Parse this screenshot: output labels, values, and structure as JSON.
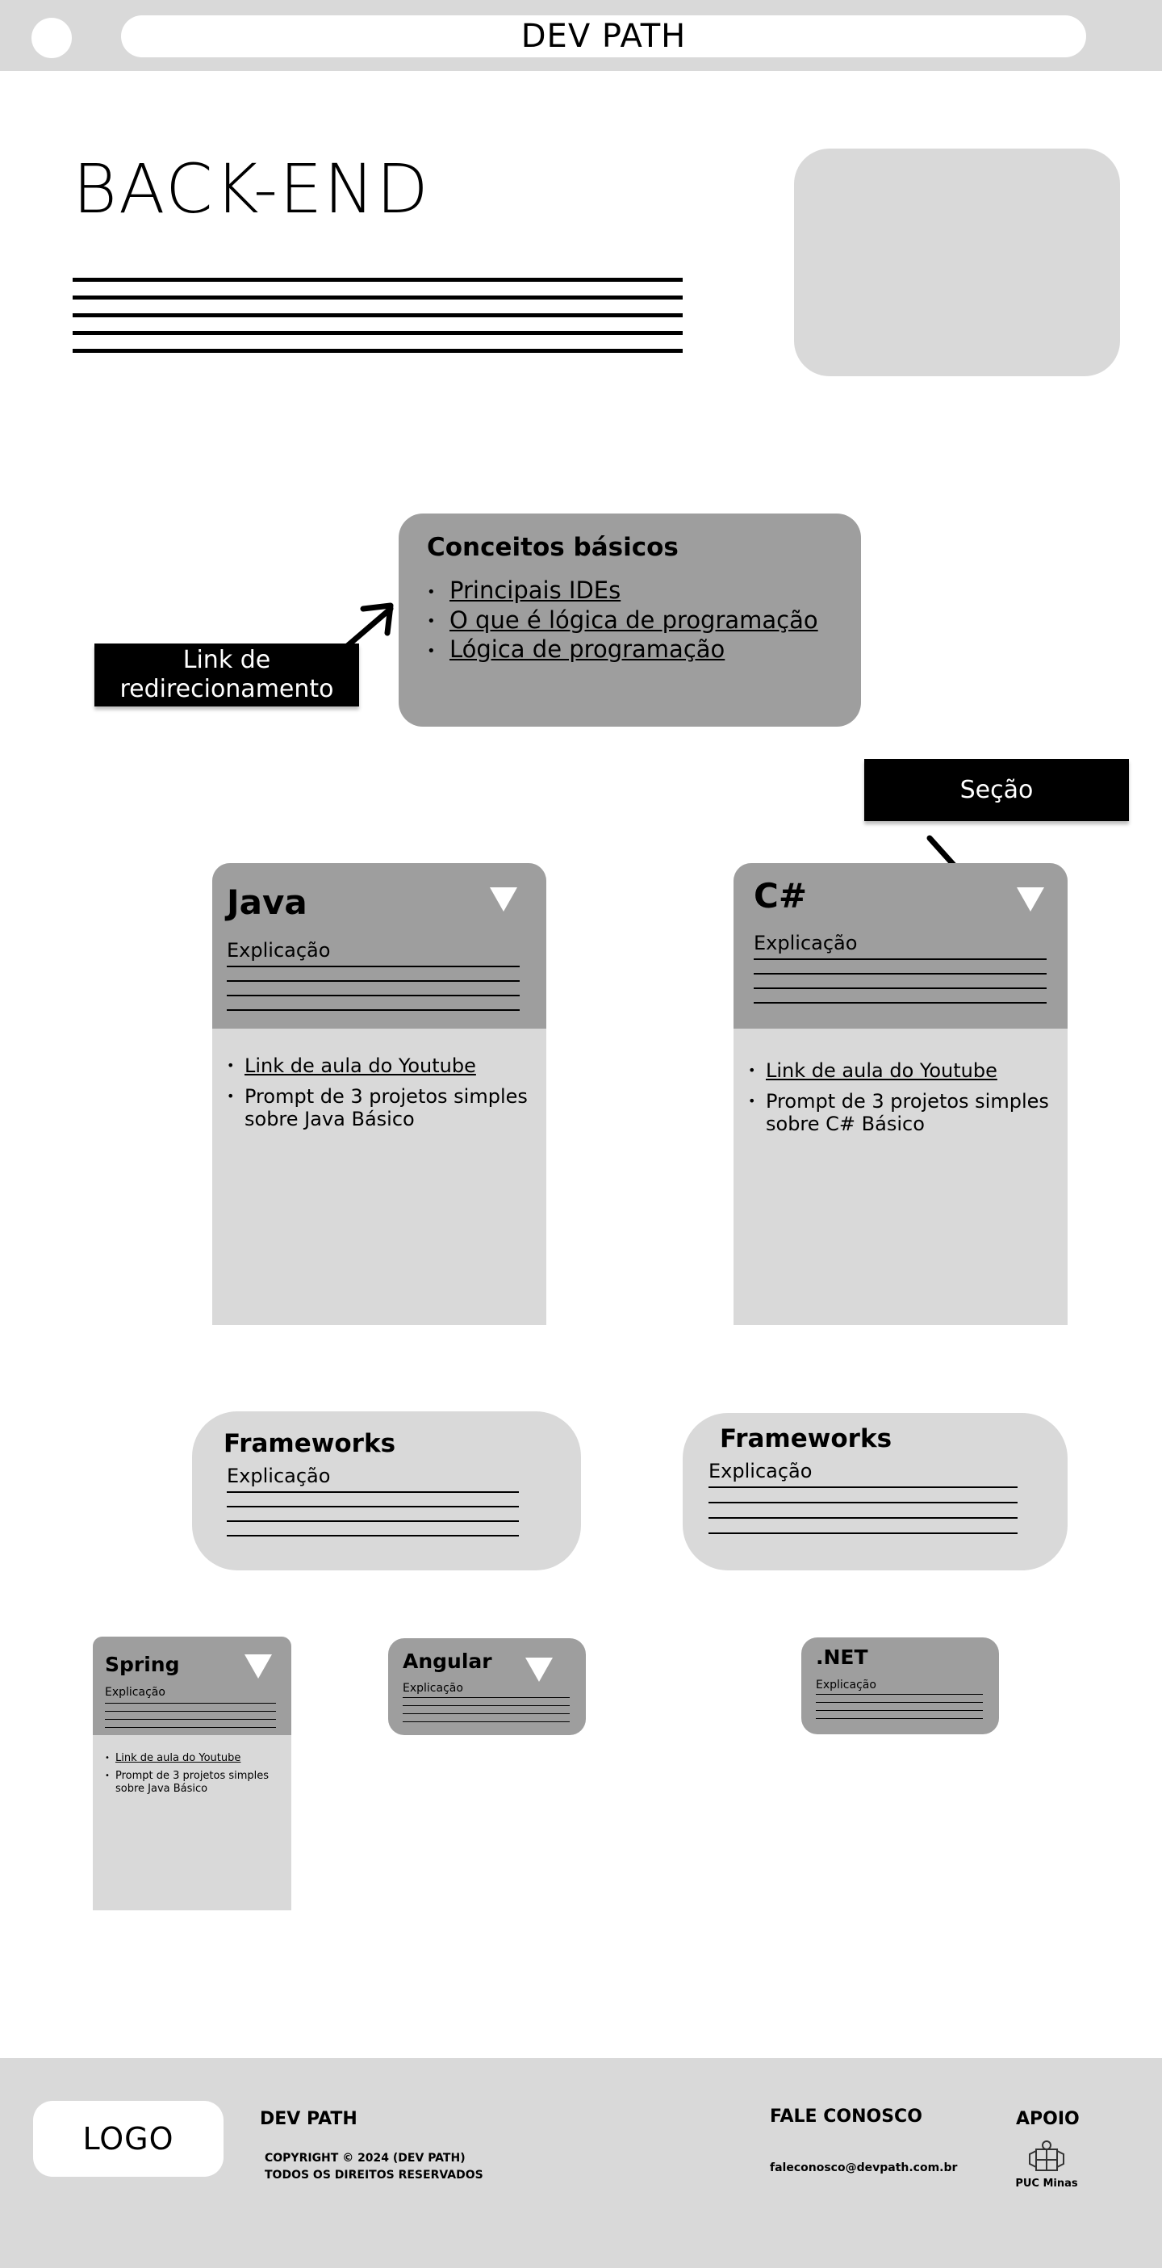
{
  "header": {
    "title": "DEV PATH"
  },
  "hero": {
    "title": "BACK-END"
  },
  "annotations": {
    "link_label": "Link de redirecionamento",
    "section_label": "Seção"
  },
  "concepts": {
    "title": "Conceitos básicos",
    "links": [
      "Principais IDEs",
      "O que é lógica de programação",
      "Lógica de programação"
    ]
  },
  "languages": [
    {
      "name": "Java",
      "explanation": "Explicação",
      "link": "Link de aula do Youtube",
      "prompt": "Prompt de 3 projetos simples sobre Java Básico"
    },
    {
      "name": "C#",
      "explanation": "Explicação",
      "link": "Link de aula do Youtube",
      "prompt": "Prompt de 3 projetos simples sobre C# Básico"
    }
  ],
  "frameworks": [
    {
      "title": "Frameworks",
      "explanation": "Explicação"
    },
    {
      "title": "Frameworks",
      "explanation": "Explicação"
    }
  ],
  "framework_cards": [
    {
      "name": "Spring",
      "explanation": "Explicação",
      "link": "Link de aula do Youtube",
      "prompt": "Prompt de 3 projetos simples sobre Java Básico"
    },
    {
      "name": "Angular",
      "explanation": "Explicação"
    },
    {
      "name": ".NET",
      "explanation": "Explicação"
    }
  ],
  "footer": {
    "logo": "LOGO",
    "brand": "DEV PATH",
    "copyright": "COPYRIGHT © 2024 (DEV PATH)",
    "rights": "TODOS OS DIREITOS RESERVADOS",
    "contact_title": "FALE CONOSCO",
    "contact_email": "faleconosco@devpath.com.br",
    "support_title": "APOIO",
    "support_name": "PUC Minas"
  },
  "icons": [
    "triangle-down-icon",
    "arrow-icon",
    "crest-icon"
  ]
}
